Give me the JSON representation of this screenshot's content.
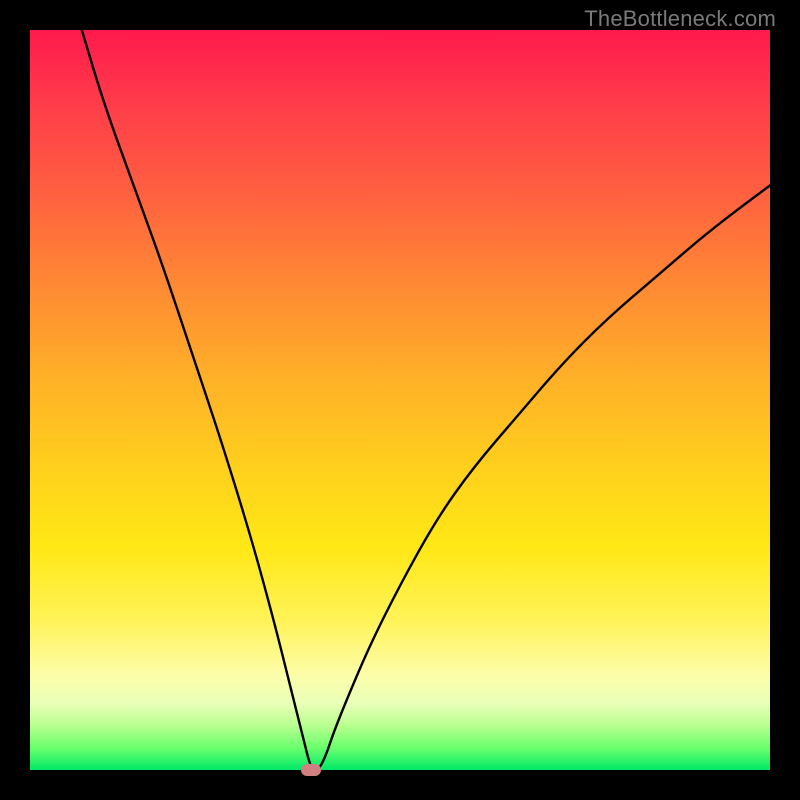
{
  "watermark": "TheBottleneck.com",
  "colors": {
    "frame": "#000000",
    "curve_stroke": "#000000",
    "marker": "#d08080",
    "gradient_stops": [
      "#ff1a4d",
      "#ff3c4a",
      "#ff6040",
      "#ff8b33",
      "#ffb327",
      "#ffd21c",
      "#ffe816",
      "#fff35a",
      "#fdfda8",
      "#e9ffb8",
      "#b8ff8f",
      "#6aff6d",
      "#00e867"
    ]
  },
  "chart_data": {
    "type": "line",
    "title": "",
    "xlabel": "",
    "ylabel": "",
    "xlim": [
      0,
      100
    ],
    "ylim": [
      0,
      100
    ],
    "grid": false,
    "note": "V-shaped bottleneck curve; minimum near x≈38. y represents bottleneck percentage (0 at bottom, 100 at top). Values are estimated from pixel positions.",
    "series": [
      {
        "name": "bottleneck-curve",
        "x": [
          7,
          10,
          14,
          18,
          22,
          26,
          30,
          33,
          35,
          37,
          38,
          39,
          40,
          41,
          43,
          46,
          50,
          55,
          60,
          66,
          72,
          78,
          85,
          92,
          100
        ],
        "y": [
          100,
          90,
          79,
          68,
          56,
          44,
          31,
          20,
          12,
          4,
          0,
          0,
          2,
          5,
          10,
          17,
          25,
          34,
          41,
          48,
          55,
          61,
          67,
          73,
          79
        ]
      }
    ],
    "marker": {
      "x": 38,
      "y": 0,
      "shape": "rounded-rect",
      "color": "#d08080"
    },
    "background": "vertical rainbow gradient red→orange→yellow→green"
  }
}
